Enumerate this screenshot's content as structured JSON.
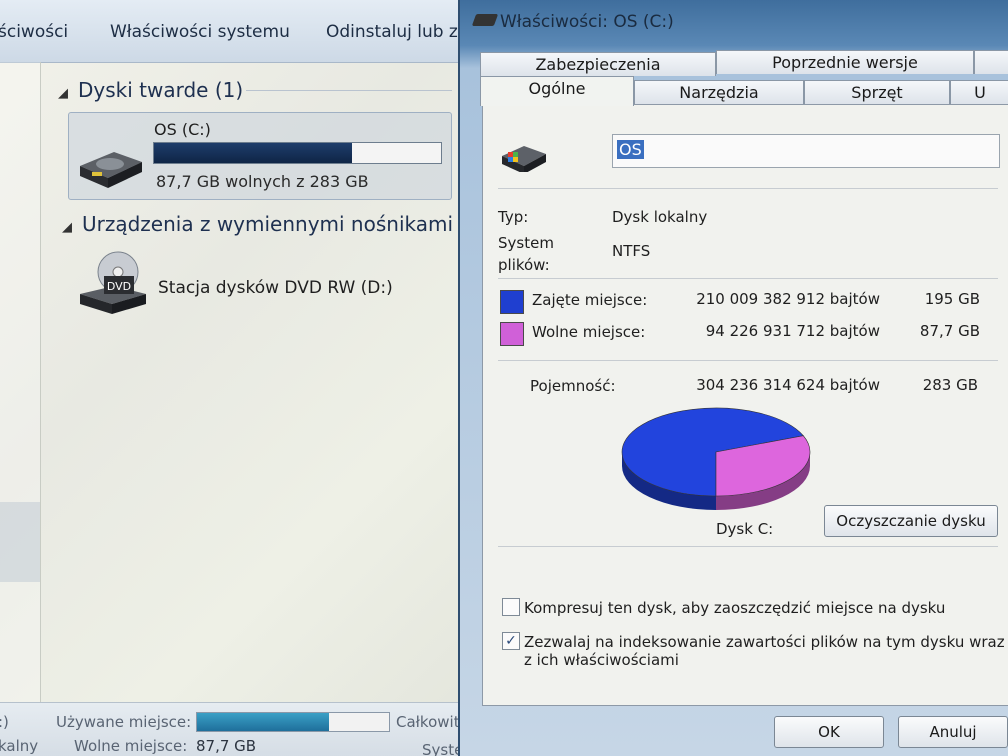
{
  "explorer": {
    "toolbar": [
      "ściwości",
      "Właściwości systemu",
      "Odinstaluj lub z"
    ],
    "hard_disks_header": "Dyski twarde (1)",
    "drive_name": "OS (C:)",
    "drive_free": "87,7 GB wolnych z 283 GB",
    "drive_used_fraction": 0.69,
    "removable_header": "Urządzenia z wymiennymi nośnikami p",
    "dvd_icon_text": "DVD",
    "dvd_label": "Stacja dysków DVD RW (D:)",
    "status": {
      "edge1": ":)",
      "edge2": "kalny",
      "used_label": "Używane miejsce:",
      "free_label": "Wolne miejsce:",
      "free_value": "87,7 GB",
      "total_cut": "Całkowit",
      "system_cut": "Syste",
      "used_fraction": 0.69
    }
  },
  "dialog": {
    "title": "Właściwości: OS (C:)",
    "tabs_back": [
      "Zabezpieczenia",
      "Poprzednie wersje"
    ],
    "tabs_front": [
      "Ogólne",
      "Narzędzia",
      "Sprzęt",
      "U"
    ],
    "name_value": "OS",
    "type_label": "Typ:",
    "type_value": "Dysk lokalny",
    "fs_label_1": "System",
    "fs_label_2": "plików:",
    "fs_value": "NTFS",
    "used_label": "Zajęte miejsce:",
    "used_bytes": "210 009 382 912 bajtów",
    "used_gb": "195 GB",
    "free_label": "Wolne miejsce:",
    "free_bytes": "94 226 931 712 bajtów",
    "free_gb": "87,7 GB",
    "capacity_label": "Pojemność:",
    "capacity_bytes": "304 236 314 624 bajtów",
    "capacity_gb": "283 GB",
    "disk_label": "Dysk C:",
    "cleanup_button": "Oczyszczanie dysku",
    "compress_label": "Kompresuj ten dysk, aby zaoszczędzić miejsce na dysku",
    "compress_checked": false,
    "index_label_1": "Zezwalaj na indeksowanie zawartości plików na tym dysku wraz",
    "index_label_2": "z ich właściwościami",
    "index_checked": true,
    "ok_button": "OK",
    "cancel_button": "Anuluj",
    "colors": {
      "used": "#1f3fd0",
      "free": "#d060d8"
    }
  },
  "chart_data": {
    "type": "pie",
    "categories": [
      "Zajęte miejsce",
      "Wolne miejsce"
    ],
    "values": [
      195,
      87.7
    ],
    "colors": [
      "#2244dd",
      "#dd66dd"
    ]
  }
}
